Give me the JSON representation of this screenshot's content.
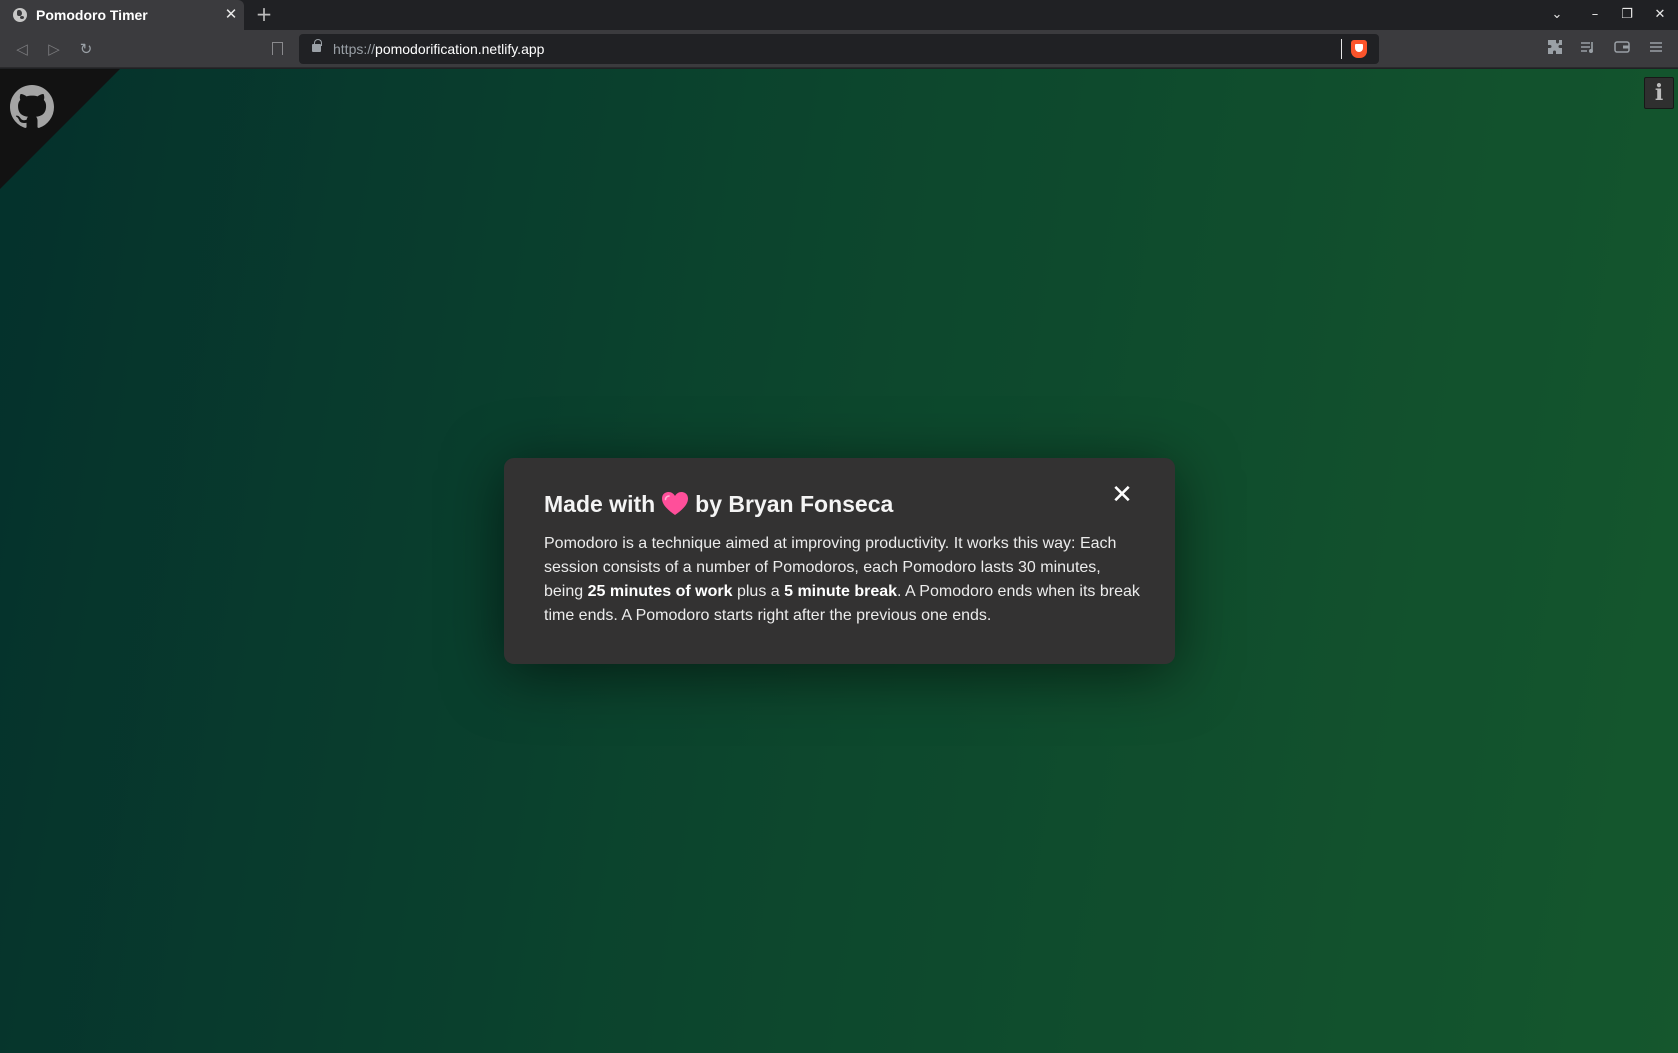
{
  "browser": {
    "tab": {
      "title": "Pomodoro Timer",
      "close_glyph": "✕"
    },
    "new_tab_glyph": "+",
    "window_controls": {
      "tab_search": "⌄",
      "minimize": "–",
      "restore": "❐",
      "close": "✕"
    },
    "nav": {
      "back": "◁",
      "forward": "▷",
      "reload": "↻"
    },
    "url": {
      "scheme": "https://",
      "host": "pomodorification.netlify.app"
    },
    "toolbar_icons": [
      "extensions-icon",
      "playlist-icon",
      "wallet-icon",
      "menu-icon"
    ]
  },
  "page": {
    "info_button_label": "i",
    "modal": {
      "title_before": "Made with",
      "title_after": "by Bryan Fonseca",
      "close_glyph": "✕",
      "body_part1": "Pomodoro is a technique aimed at improving productivity. It works this way: Each session consists of a number of Pomodoros, each Pomodoro lasts 30 minutes, being ",
      "body_bold1": "25 minutes of work",
      "body_part2": " plus a ",
      "body_bold2": "5 minute break",
      "body_part3": ". A Pomodoro ends when its break time ends. A Pomodoro starts right after the previous one ends."
    }
  },
  "colors": {
    "gradient_start": "#063c36",
    "gradient_end": "#1a6b38",
    "modal_bg": "#333232",
    "heart": "#ff4f9a"
  }
}
